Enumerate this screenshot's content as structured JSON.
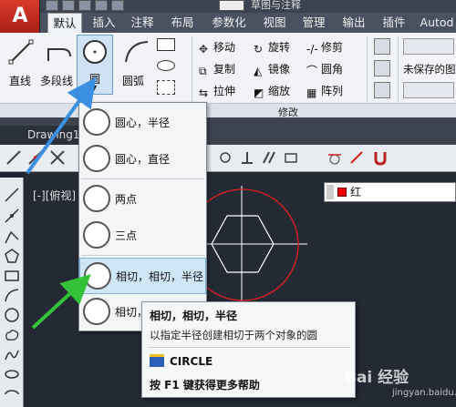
{
  "title": "草图与注释",
  "tabs": [
    "默认",
    "插入",
    "注释",
    "布局",
    "参数化",
    "视图",
    "管理",
    "输出",
    "插件",
    "Autod"
  ],
  "ribbon": {
    "draw": {
      "line": "直线",
      "polyline": "多段线",
      "circle": "圆",
      "arc": "圆弧"
    },
    "modify": {
      "move": "移动",
      "rotate": "旋转",
      "trim": "修剪",
      "copy": "复制",
      "mirror": "镜像",
      "fillet": "圆角",
      "stretch": "拉伸",
      "scale": "缩放",
      "array": "阵列",
      "panel_label": "修改"
    },
    "right_text": "未保存的图"
  },
  "doc_tab": "Drawing1",
  "view_label": "[-][俯视]",
  "layer": {
    "name": "红",
    "color": "#e00000"
  },
  "menu": {
    "items": [
      "圆心，半径",
      "圆心，直径",
      "两点",
      "三点",
      "相切，相切，半径",
      "相切，"
    ]
  },
  "tooltip": {
    "title": "相切，相切，半径",
    "desc": "以指定半径创建相切于两个对象的圆",
    "command": "CIRCLE",
    "help": "按 F1 键获得更多帮助"
  },
  "watermark": {
    "brand": "Bai 经验",
    "url": "jingyan.baidu.com"
  }
}
